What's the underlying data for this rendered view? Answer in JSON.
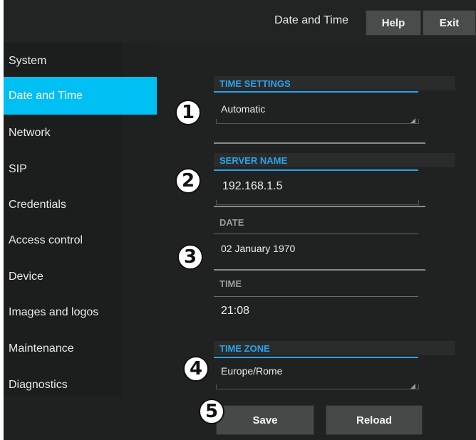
{
  "header": {
    "title": "Date and Time",
    "help_label": "Help",
    "exit_label": "Exit"
  },
  "sidebar": {
    "items": [
      {
        "label": "System"
      },
      {
        "label": "Date and Time",
        "active": true
      },
      {
        "label": "Network"
      },
      {
        "label": "SIP"
      },
      {
        "label": "Credentials"
      },
      {
        "label": "Access control"
      },
      {
        "label": "Device"
      },
      {
        "label": "Images and logos"
      },
      {
        "label": "Maintenance"
      },
      {
        "label": "Diagnostics"
      }
    ]
  },
  "form": {
    "time_settings": {
      "label": "TIME SETTINGS",
      "value": "Automatic"
    },
    "server_name": {
      "label": "SERVER NAME",
      "value": "192.168.1.5"
    },
    "date": {
      "label": "DATE",
      "value": "02 January 1970"
    },
    "time": {
      "label": "TIME",
      "value": "21:08"
    },
    "time_zone": {
      "label": "TIME ZONE",
      "value": "Europe/Rome"
    }
  },
  "markers": [
    "1",
    "2",
    "3",
    "4",
    "5"
  ],
  "buttons": {
    "save_label": "Save",
    "reload_label": "Reload"
  },
  "colors": {
    "accent": "#2ba3ea",
    "active_nav": "#00bff2",
    "background": "#1f2121"
  }
}
